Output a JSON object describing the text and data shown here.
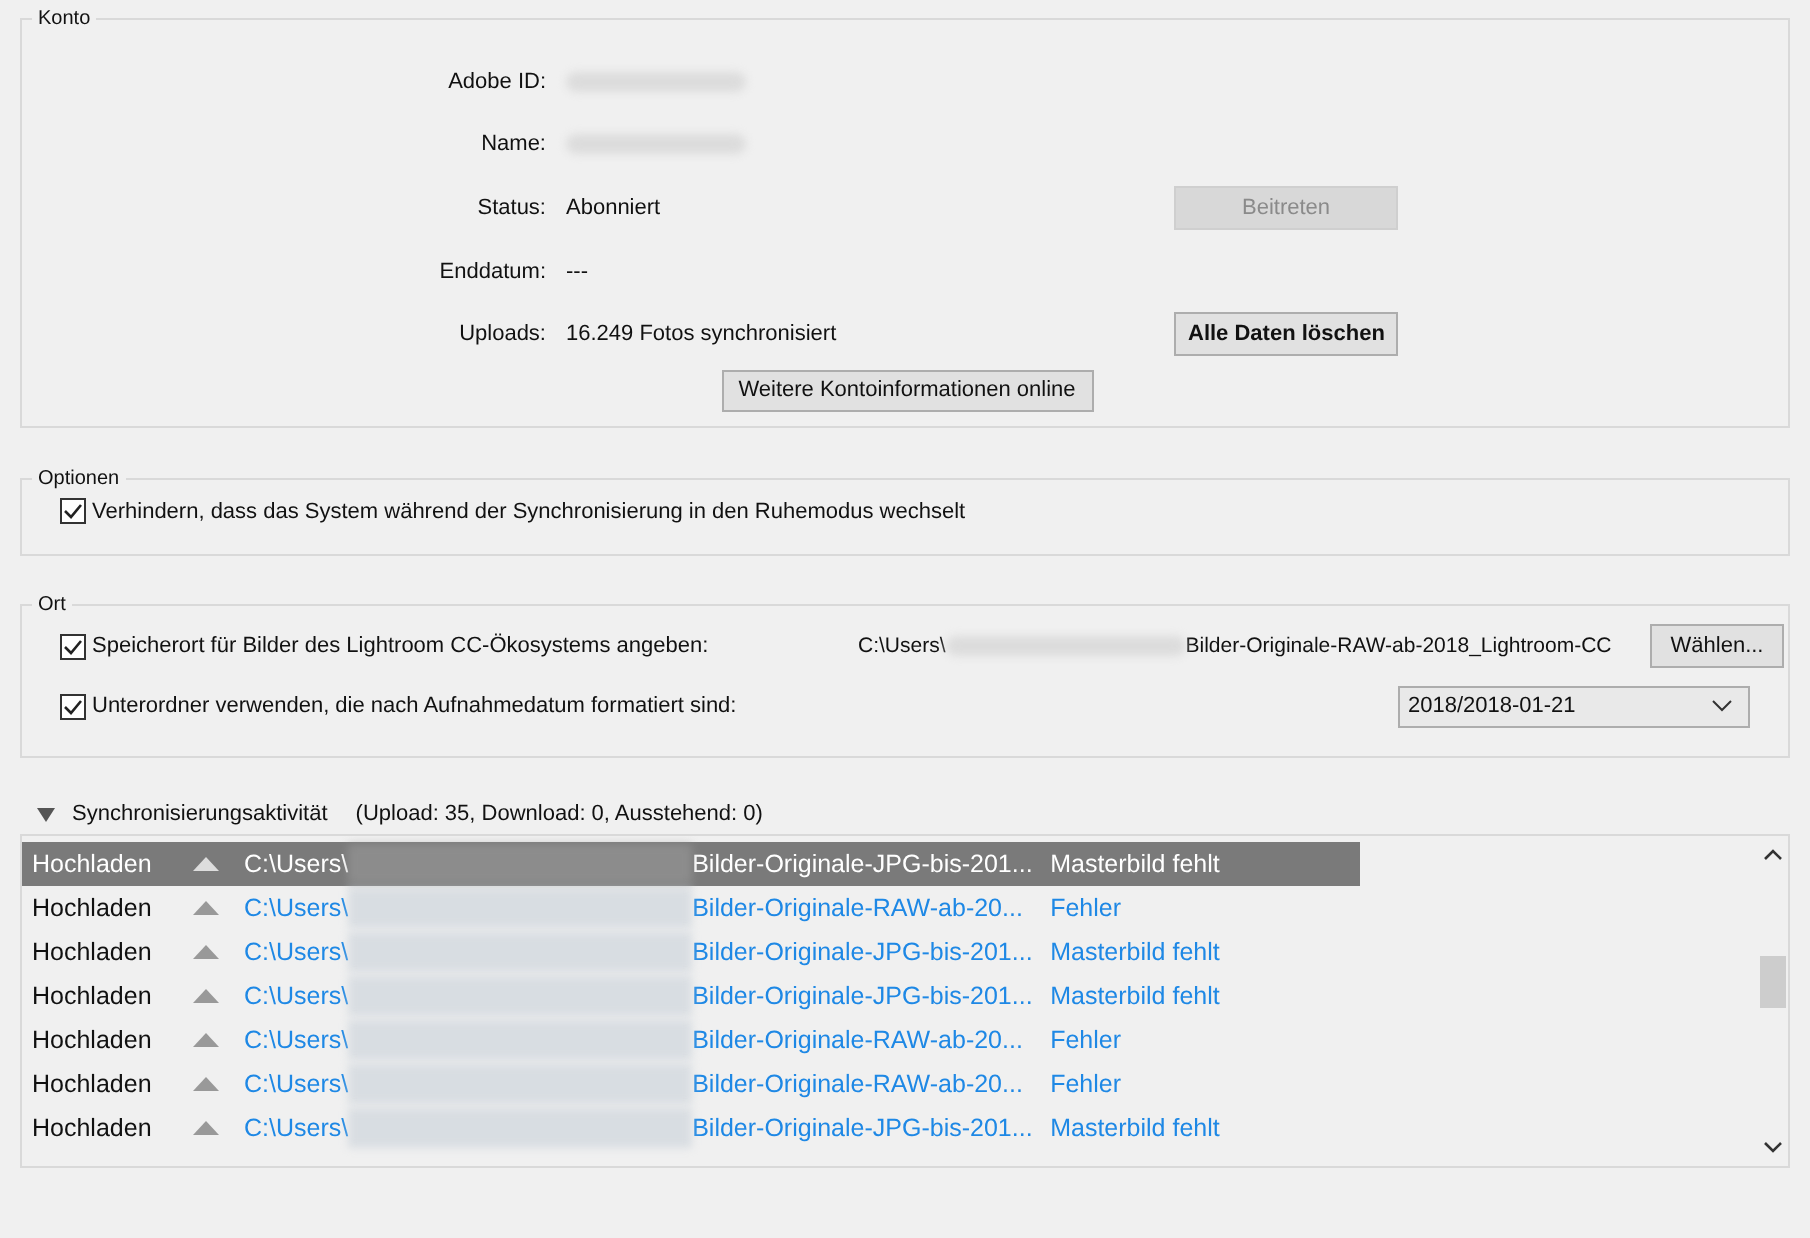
{
  "account": {
    "title": "Konto",
    "fields": [
      {
        "label": "Adobe ID:",
        "kind": "redacted"
      },
      {
        "label": "Name:",
        "kind": "redacted"
      },
      {
        "label": "Status:",
        "kind": "text",
        "value": "Abonniert",
        "button": {
          "label": "Beitreten",
          "disabled": true,
          "bold": false
        }
      },
      {
        "label": "Enddatum:",
        "kind": "text",
        "value": "---"
      },
      {
        "label": "Uploads:",
        "kind": "text",
        "value": "16.249 Fotos synchronisiert",
        "button": {
          "label": "Alle Daten löschen",
          "disabled": false,
          "bold": true
        }
      }
    ],
    "more_button": "Weitere Kontoinformationen online"
  },
  "options": {
    "title": "Optionen",
    "checkboxes": [
      {
        "label": "Verhindern, dass das System während der Synchronisierung in den Ruhemodus wechselt",
        "checked": true
      }
    ]
  },
  "location": {
    "title": "Ort",
    "storage": {
      "label": "Speicherort für Bilder des Lightroom CC-Ökosystems angeben:",
      "checked": true,
      "path_start": "C:\\Users\\",
      "path_end": "Bilder-Originale-RAW-ab-2018_Lightroom-CC",
      "button": "Wählen..."
    },
    "subfolders": {
      "label": "Unterordner verwenden, die nach Aufnahmedatum formatiert sind:",
      "checked": true,
      "value": "2018/2018-01-21"
    }
  },
  "sync": {
    "title": "Synchronisierungsaktivität",
    "expanded": true,
    "summary": "(Upload: 35, Download: 0, Ausstehend: 0)",
    "rows": [
      {
        "action": "Hochladen",
        "path_start": "C:\\Users\\",
        "file": "Bilder-Originale-JPG-bis-201...",
        "status": "Masterbild fehlt",
        "selected": true
      },
      {
        "action": "Hochladen",
        "path_start": "C:\\Users\\",
        "file": "Bilder-Originale-RAW-ab-20...",
        "status": "Fehler",
        "selected": false
      },
      {
        "action": "Hochladen",
        "path_start": "C:\\Users\\",
        "file": "Bilder-Originale-JPG-bis-201...",
        "status": "Masterbild fehlt",
        "selected": false
      },
      {
        "action": "Hochladen",
        "path_start": "C:\\Users\\",
        "file": "Bilder-Originale-JPG-bis-201...",
        "status": "Masterbild fehlt",
        "selected": false
      },
      {
        "action": "Hochladen",
        "path_start": "C:\\Users\\",
        "file": "Bilder-Originale-RAW-ab-20...",
        "status": "Fehler",
        "selected": false
      },
      {
        "action": "Hochladen",
        "path_start": "C:\\Users\\",
        "file": "Bilder-Originale-RAW-ab-20...",
        "status": "Fehler",
        "selected": false
      },
      {
        "action": "Hochladen",
        "path_start": "C:\\Users\\",
        "file": "Bilder-Originale-JPG-bis-201...",
        "status": "Masterbild fehlt",
        "selected": false
      }
    ]
  }
}
